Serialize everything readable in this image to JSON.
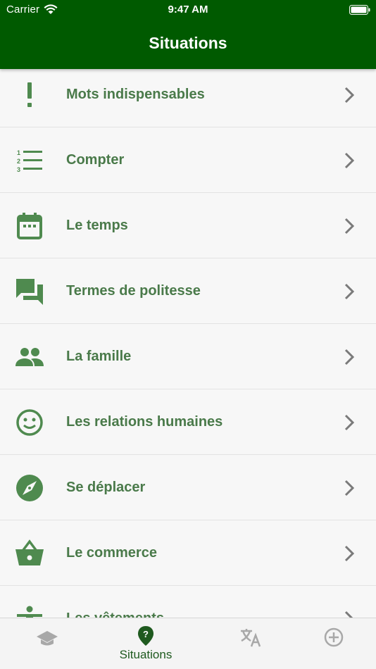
{
  "status_bar": {
    "carrier": "Carrier",
    "time": "9:47 AM"
  },
  "nav": {
    "title": "Situations"
  },
  "list": {
    "items": [
      {
        "label": "Mots indispensables",
        "icon": "exclamation-icon"
      },
      {
        "label": "Compter",
        "icon": "numbered-list-icon"
      },
      {
        "label": "Le temps",
        "icon": "calendar-icon"
      },
      {
        "label": "Termes de politesse",
        "icon": "chat-bubbles-icon"
      },
      {
        "label": "La famille",
        "icon": "people-icon"
      },
      {
        "label": "Les relations humaines",
        "icon": "smiley-icon"
      },
      {
        "label": "Se déplacer",
        "icon": "compass-icon"
      },
      {
        "label": "Le commerce",
        "icon": "basket-icon"
      },
      {
        "label": "Les vêtements",
        "icon": "person-icon"
      }
    ]
  },
  "tabbar": {
    "tabs": [
      {
        "icon": "graduation-cap-icon",
        "label": ""
      },
      {
        "icon": "location-help-icon",
        "label": "Situations",
        "selected": true
      },
      {
        "icon": "translate-icon",
        "label": ""
      },
      {
        "icon": "plus-circle-icon",
        "label": ""
      }
    ]
  },
  "colors": {
    "header": "#005a00",
    "accent_text": "#4a7a4a",
    "icon": "#4f8a4f",
    "chevron": "#7a7a7a",
    "tab_inactive": "#a8a8a8",
    "tab_active": "#1f5a1f"
  }
}
